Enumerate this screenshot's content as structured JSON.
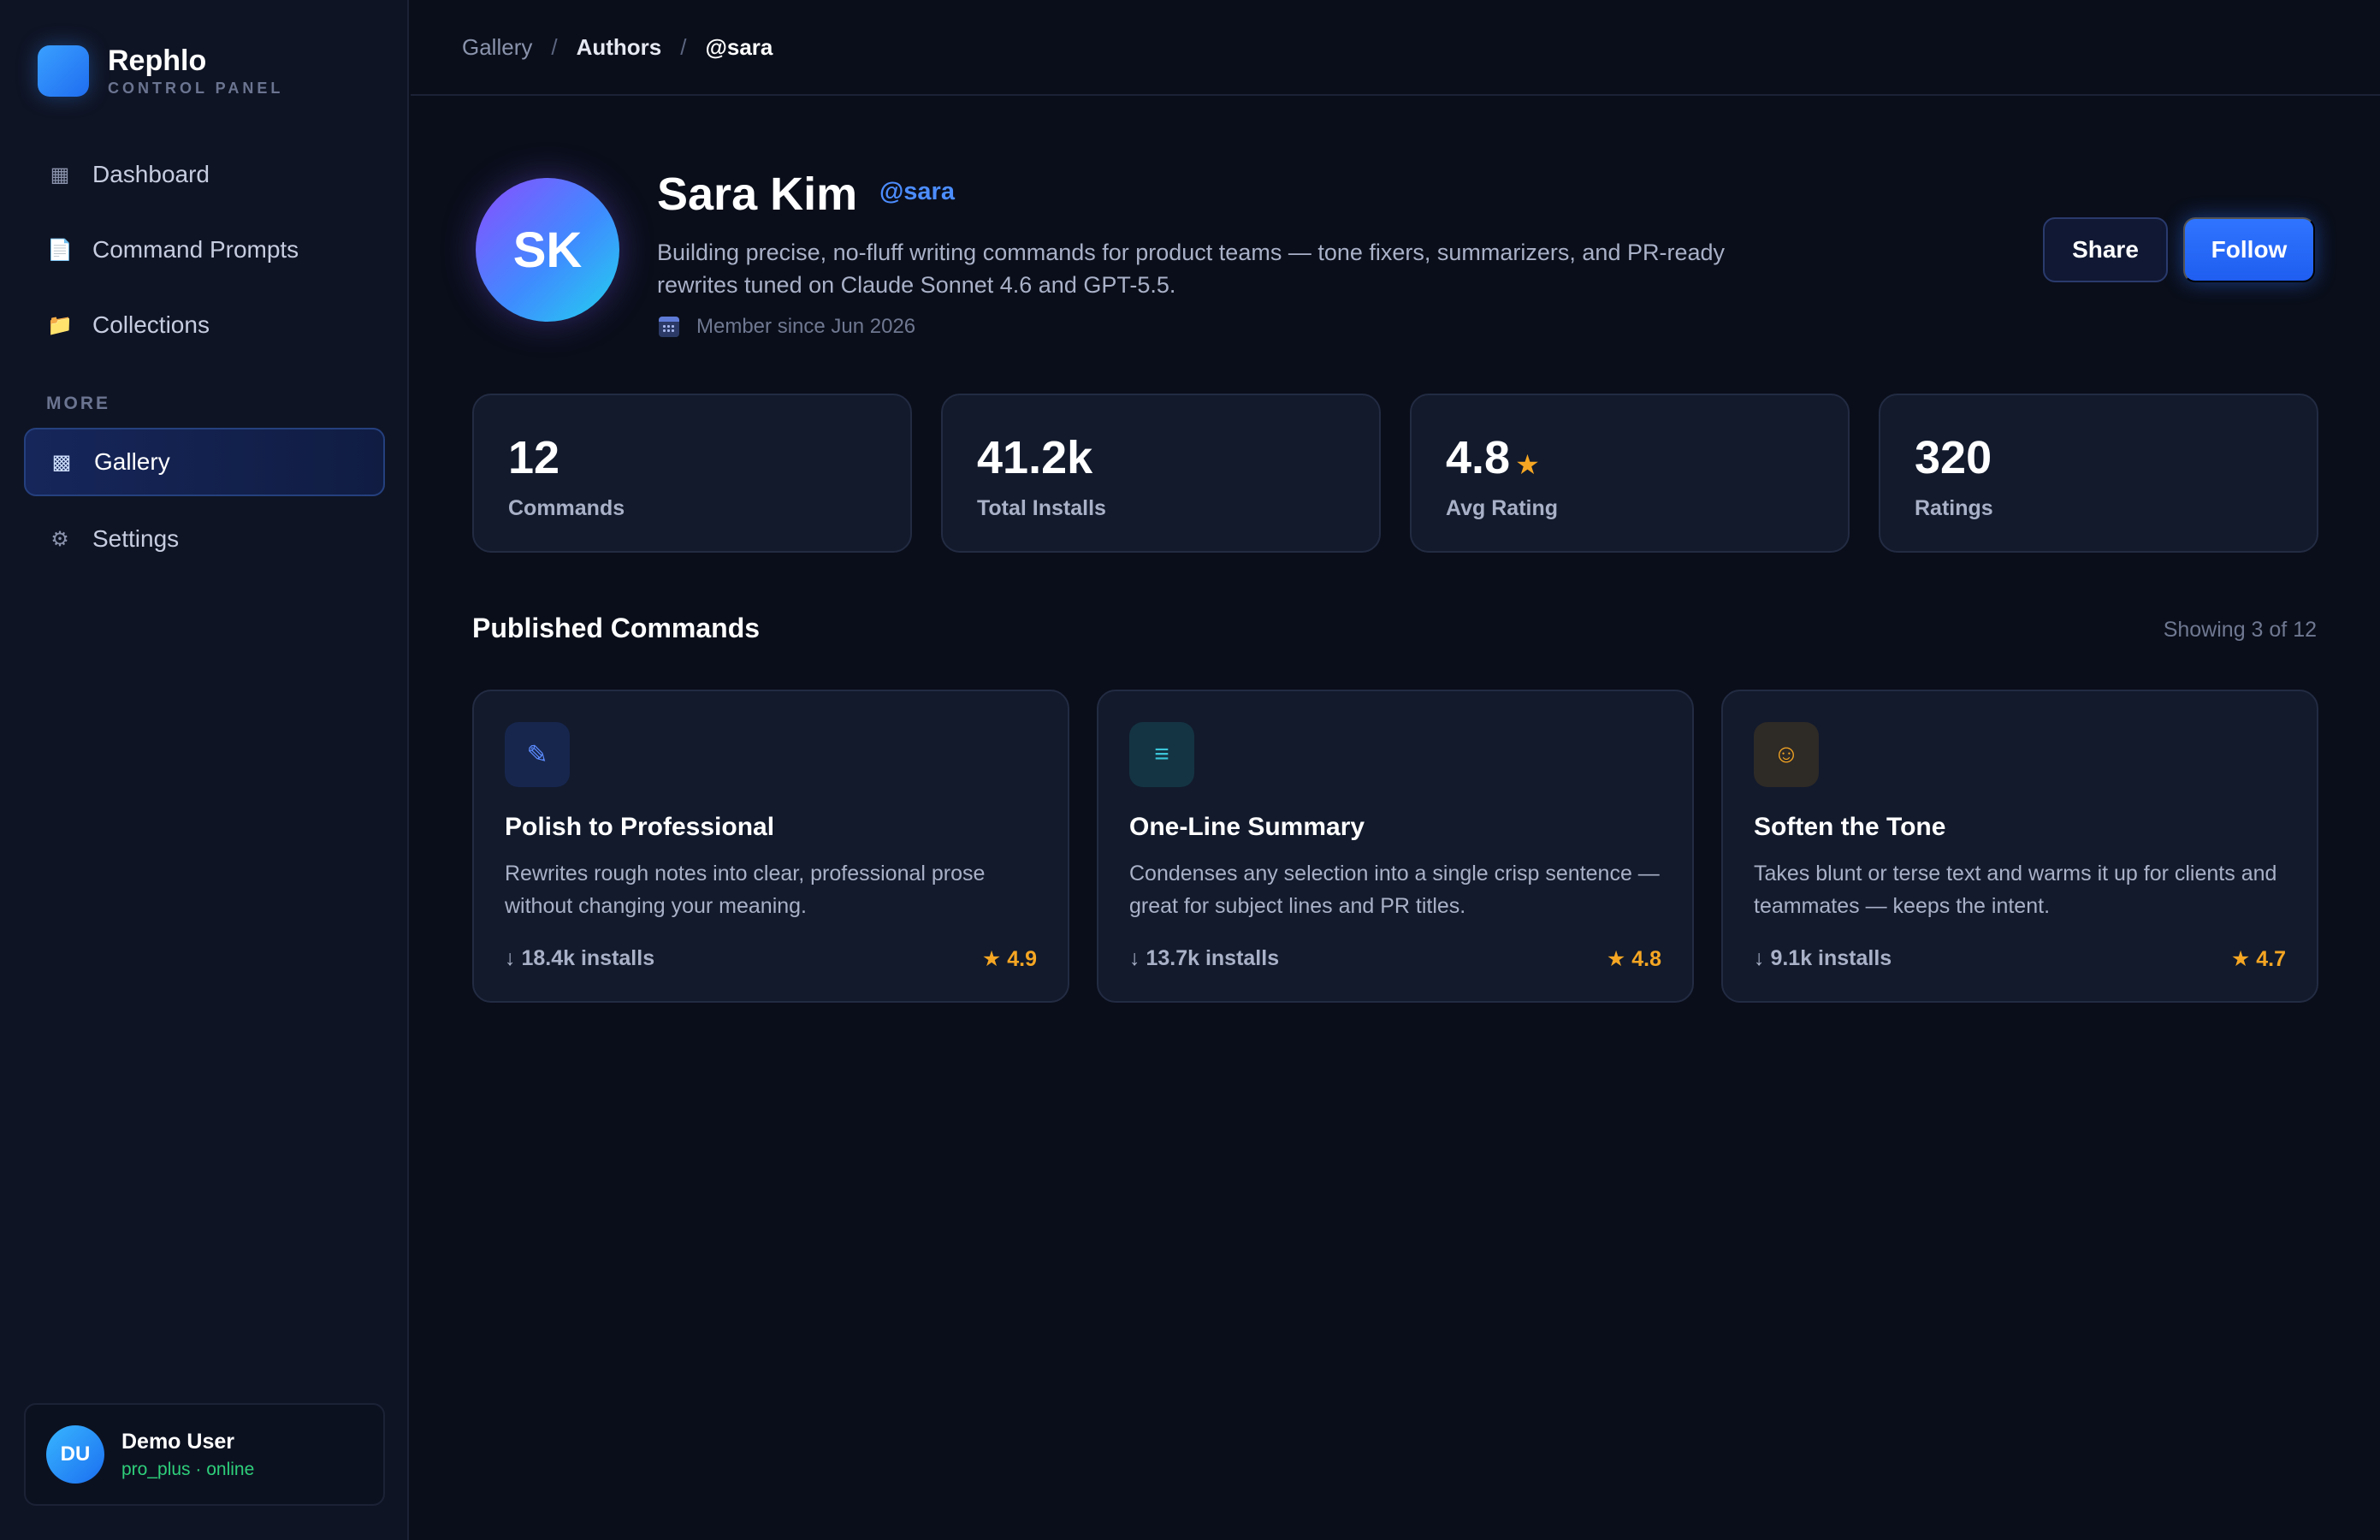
{
  "brand": {
    "name": "Rephlo",
    "subtitle": "CONTROL PANEL"
  },
  "sidebar": {
    "items": [
      {
        "label": "Dashboard",
        "icon": "▦"
      },
      {
        "label": "Command Prompts",
        "icon": "📄"
      },
      {
        "label": "Collections",
        "icon": "📁"
      }
    ],
    "section_label": "MORE",
    "more_items": [
      {
        "label": "Gallery",
        "icon": "▩",
        "active": true
      },
      {
        "label": "Settings",
        "icon": "⚙"
      }
    ]
  },
  "user": {
    "initials": "DU",
    "name": "Demo User",
    "status": "pro_plus · online"
  },
  "breadcrumb": {
    "items": [
      "Gallery",
      "Authors",
      "@sara"
    ],
    "separator": "/"
  },
  "profile": {
    "initials": "SK",
    "name": "Sara Kim",
    "handle": "@sara",
    "bio": "Building precise, no-fluff writing commands for product teams — tone fixers, summarizers, and PR-ready rewrites tuned on Claude Sonnet 4.6 and GPT-5.5.",
    "member_since": "Member since Jun 2026"
  },
  "actions": {
    "share": "Share",
    "follow": "Follow"
  },
  "stats": [
    {
      "value": "12",
      "label": "Commands"
    },
    {
      "value": "41.2k",
      "label": "Total Installs"
    },
    {
      "value": "4.8",
      "star": "★",
      "label": "Avg Rating"
    },
    {
      "value": "320",
      "label": "Ratings"
    }
  ],
  "published": {
    "title": "Published Commands",
    "showing": "Showing 3 of 12",
    "cards": [
      {
        "icon": "✎",
        "icon_name": "pencil-icon",
        "icon_bg": "#17264d",
        "icon_color": "#5b8cff",
        "title": "Polish to Professional",
        "desc": "Rewrites rough notes into clear, professional prose without changing your meaning.",
        "installs": "↓ 18.4k installs",
        "rating": "★ 4.9"
      },
      {
        "icon": "≡",
        "icon_name": "lines-icon",
        "icon_bg": "#143443",
        "icon_color": "#3cc6d9",
        "title": "One-Line Summary",
        "desc": "Condenses any selection into a single crisp sentence — great for subject lines and PR titles.",
        "installs": "↓ 13.7k installs",
        "rating": "★ 4.8"
      },
      {
        "icon": "☺",
        "icon_name": "smile-icon",
        "icon_bg": "#2e2a26",
        "icon_color": "#f5a623",
        "title": "Soften the Tone",
        "desc": "Takes blunt or terse text and warms it up for clients and teammates — keeps the intent.",
        "installs": "↓ 9.1k installs",
        "rating": "★ 4.7"
      }
    ]
  },
  "colors": {
    "accent": "#2f74ff",
    "star": "#f5a623",
    "online": "#2ecf7a",
    "background": "#0a0e1a"
  }
}
